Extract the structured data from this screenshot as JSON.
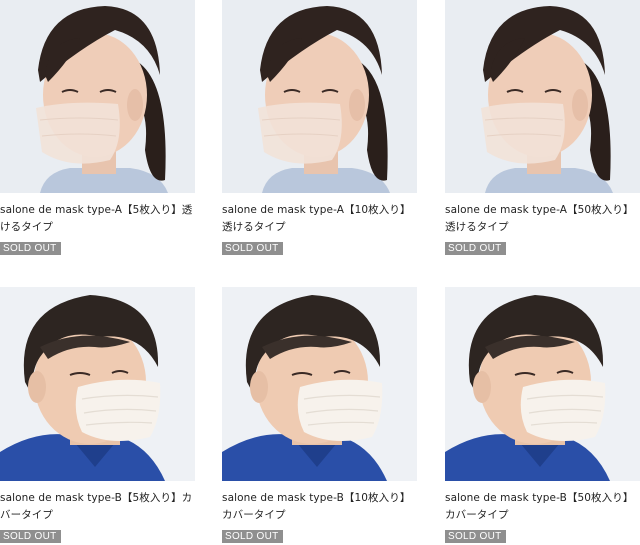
{
  "products": [
    {
      "title": "salone de mask type-A【5枚入り】透けるタイプ",
      "status": "SOLD OUT",
      "image": "woman-wearing-sheer-mask"
    },
    {
      "title": "salone de mask type-A【10枚入り】透けるタイプ",
      "status": "SOLD OUT",
      "image": "woman-wearing-sheer-mask"
    },
    {
      "title": "salone de mask type-A【50枚入り】透けるタイプ",
      "status": "SOLD OUT",
      "image": "woman-wearing-sheer-mask"
    },
    {
      "title": "salone de mask type-B【5枚入り】カバータイプ",
      "status": "SOLD OUT",
      "image": "man-wearing-cover-mask"
    },
    {
      "title": "salone de mask type-B【10枚入り】カバータイプ",
      "status": "SOLD OUT",
      "image": "man-wearing-cover-mask"
    },
    {
      "title": "salone de mask type-B【50枚入り】カバータイプ",
      "status": "SOLD OUT",
      "image": "man-wearing-cover-mask"
    }
  ],
  "colors": {
    "badge": "#8f8f8f",
    "photo_bg": "#e9edf2",
    "shirt": "#2a4fa8"
  }
}
